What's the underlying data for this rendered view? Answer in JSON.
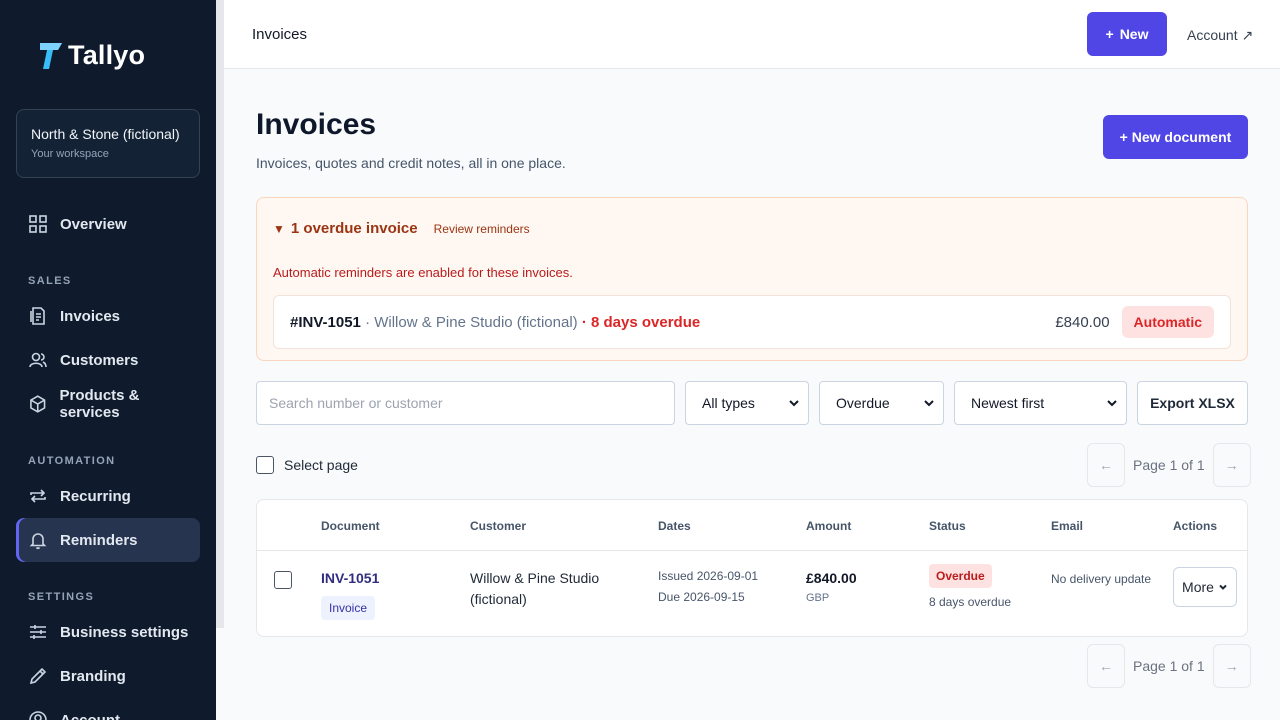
{
  "brand": {
    "name": "Tallyo",
    "accent": "#4f46e5",
    "sidebar_bg": "#0f1b2d"
  },
  "workspace": {
    "name": "North & Stone (fictional)",
    "subtitle": "Your workspace"
  },
  "sidebar": {
    "overview": "Overview",
    "sections": {
      "sales": "SALES",
      "automation": "AUTOMATION",
      "settings": "SETTINGS"
    },
    "items": {
      "invoices": "Invoices",
      "customers": "Customers",
      "products": "Products & services",
      "recurring": "Recurring",
      "reminders": "Reminders",
      "business_settings": "Business settings",
      "branding": "Branding",
      "account": "Account"
    },
    "active": "reminders"
  },
  "topbar": {
    "title": "Invoices",
    "new_label": "New",
    "account_label": "Account ↗"
  },
  "page": {
    "title": "Invoices",
    "subtitle": "Invoices, quotes and credit notes, all in one place.",
    "new_document_label": "+ New document"
  },
  "alert": {
    "title": "1 overdue invoice",
    "link": "Review reminders",
    "note": "Automatic reminders are enabled for these invoices.",
    "row": {
      "number": "#INV-1051",
      "customer": "Willow & Pine Studio (fictional)",
      "days": "8 days overdue",
      "amount": "£840.00",
      "badge": "Automatic"
    }
  },
  "filters": {
    "search_placeholder": "Search number or customer",
    "type": "All types",
    "status": "Overdue",
    "sort": "Newest first",
    "export_label": "Export XLSX"
  },
  "select_page_label": "Select page",
  "pagination": {
    "label": "Page 1 of 1",
    "prev": "←",
    "next": "→"
  },
  "table": {
    "headers": [
      "Document",
      "Customer",
      "Dates",
      "Amount",
      "Status",
      "Email",
      "Actions"
    ],
    "rows": [
      {
        "number": "INV-1051",
        "type": "Invoice",
        "customer_line1": "Willow & Pine Studio",
        "customer_line2": "(fictional)",
        "issued": "Issued 2026-09-01",
        "due": "Due 2026-09-15",
        "amount": "£840.00",
        "currency": "GBP",
        "status": "Overdue",
        "status_sub": "8 days overdue",
        "email": "No delivery update",
        "action": "More"
      }
    ]
  }
}
